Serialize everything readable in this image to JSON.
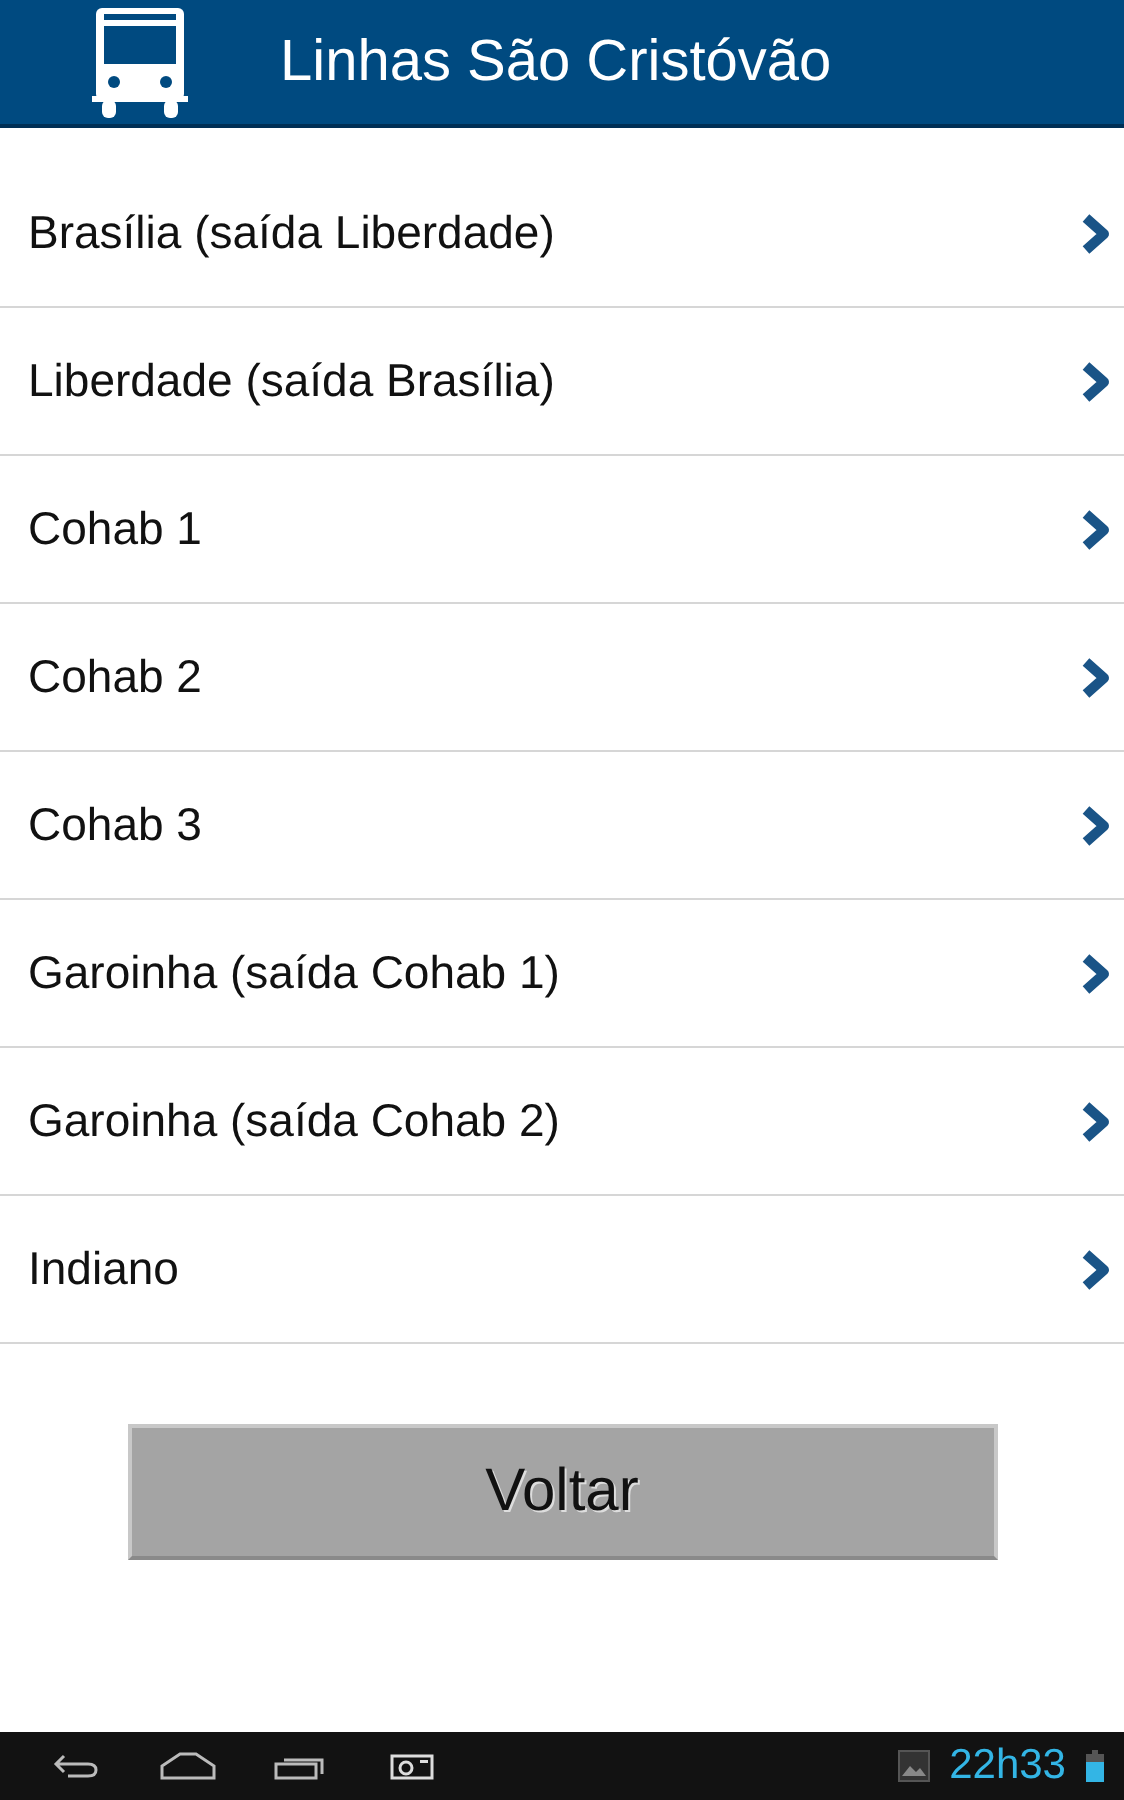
{
  "header": {
    "title": "Linhas São Cristóvão"
  },
  "lines": [
    {
      "label": "Brasília (saída Liberdade)"
    },
    {
      "label": "Liberdade (saída Brasília)"
    },
    {
      "label": "Cohab 1"
    },
    {
      "label": "Cohab 2"
    },
    {
      "label": "Cohab 3"
    },
    {
      "label": "Garoinha (saída Cohab 1)"
    },
    {
      "label": "Garoinha (saída Cohab 2)"
    },
    {
      "label": "Indiano"
    }
  ],
  "back_button": {
    "label": "Voltar"
  },
  "status_bar": {
    "time": "22h33"
  }
}
